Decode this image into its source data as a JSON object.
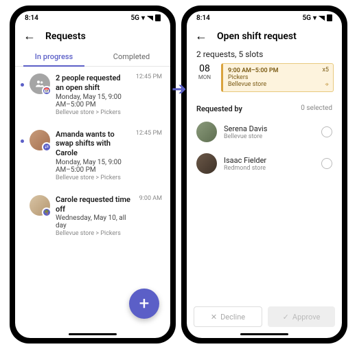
{
  "status": {
    "time": "8:14",
    "net": "5G"
  },
  "left": {
    "title": "Requests",
    "tabs": {
      "inprogress": "In progress",
      "completed": "Completed"
    },
    "items": [
      {
        "title": "2 people requested an open shift",
        "sub": "Monday, May 15, 9:00 AM–5:00 PM",
        "crumb": "Bellevue store > Pickers",
        "time": "12:45 PM"
      },
      {
        "title": "Amanda wants to swap shifts with Carole",
        "sub": "Monday, May 15, 9:00 AM–5:00 PM",
        "crumb": "Bellevue store > Pickers",
        "time": "12:45 PM"
      },
      {
        "title": "Carole requested time off",
        "sub": "Wednesday, May 10, all day",
        "crumb": "Bellevue store > Pickers",
        "time": "9:00 AM"
      }
    ],
    "fab": "+"
  },
  "right": {
    "title": "Open shift request",
    "summary": "2 requests, 5 slots",
    "date": {
      "num": "08",
      "day": "MON"
    },
    "slot": {
      "time": "9:00 AM–5:00 PM",
      "role": "Pickers",
      "store": "Bellevue store",
      "mult": "x5"
    },
    "section": {
      "label": "Requested by",
      "count": "0 selected"
    },
    "requesters": [
      {
        "name": "Serena Davis",
        "store": "Bellevue store"
      },
      {
        "name": "Isaac Fielder",
        "store": "Redmond store"
      }
    ],
    "actions": {
      "decline": "Decline",
      "approve": "Approve"
    }
  }
}
